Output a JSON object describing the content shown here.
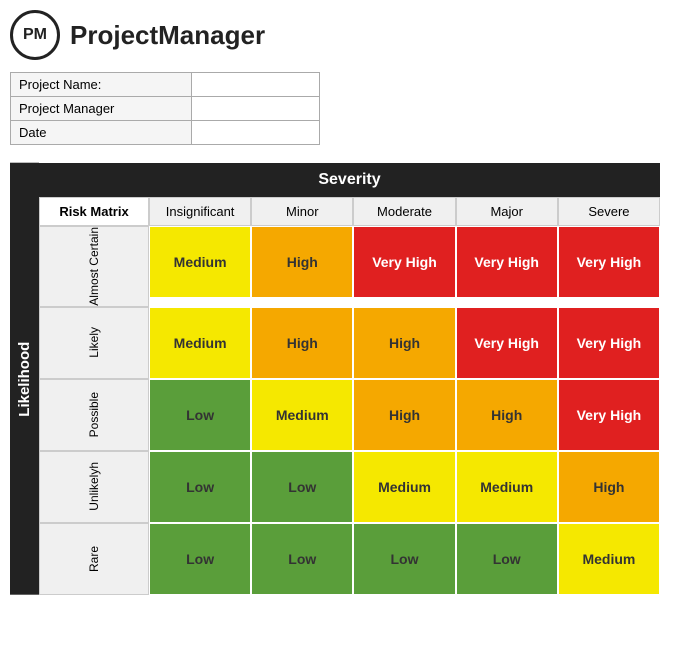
{
  "header": {
    "logo_text": "PM",
    "app_title": "ProjectManager"
  },
  "project_fields": [
    {
      "label": "Project Name:",
      "value": ""
    },
    {
      "label": "Project Manager",
      "value": ""
    },
    {
      "label": "Date",
      "value": ""
    }
  ],
  "matrix": {
    "title": "Risk Matrix",
    "severity_label": "Severity",
    "likelihood_label": "Likelihood",
    "severity_columns": [
      "Insignificant",
      "Minor",
      "Moderate",
      "Major",
      "Severe"
    ],
    "rows": [
      {
        "label": "Almost Certain",
        "cells": [
          {
            "text": "Medium",
            "level": "medium"
          },
          {
            "text": "High",
            "level": "high"
          },
          {
            "text": "Very High",
            "level": "very-high"
          },
          {
            "text": "Very High",
            "level": "very-high"
          },
          {
            "text": "Very High",
            "level": "very-high"
          }
        ]
      },
      {
        "label": "Likely",
        "cells": [
          {
            "text": "Medium",
            "level": "medium"
          },
          {
            "text": "High",
            "level": "high"
          },
          {
            "text": "High",
            "level": "high"
          },
          {
            "text": "Very High",
            "level": "very-high"
          },
          {
            "text": "Very High",
            "level": "very-high"
          }
        ]
      },
      {
        "label": "Possible",
        "cells": [
          {
            "text": "Low",
            "level": "low"
          },
          {
            "text": "Medium",
            "level": "medium"
          },
          {
            "text": "High",
            "level": "high"
          },
          {
            "text": "High",
            "level": "high"
          },
          {
            "text": "Very High",
            "level": "very-high"
          }
        ]
      },
      {
        "label": "Unlikelyh",
        "cells": [
          {
            "text": "Low",
            "level": "low"
          },
          {
            "text": "Low",
            "level": "low"
          },
          {
            "text": "Medium",
            "level": "medium"
          },
          {
            "text": "Medium",
            "level": "medium"
          },
          {
            "text": "High",
            "level": "high"
          }
        ]
      },
      {
        "label": "Rare",
        "cells": [
          {
            "text": "Low",
            "level": "low"
          },
          {
            "text": "Low",
            "level": "low"
          },
          {
            "text": "Low",
            "level": "low"
          },
          {
            "text": "Low",
            "level": "low"
          },
          {
            "text": "Medium",
            "level": "medium"
          }
        ]
      }
    ]
  }
}
